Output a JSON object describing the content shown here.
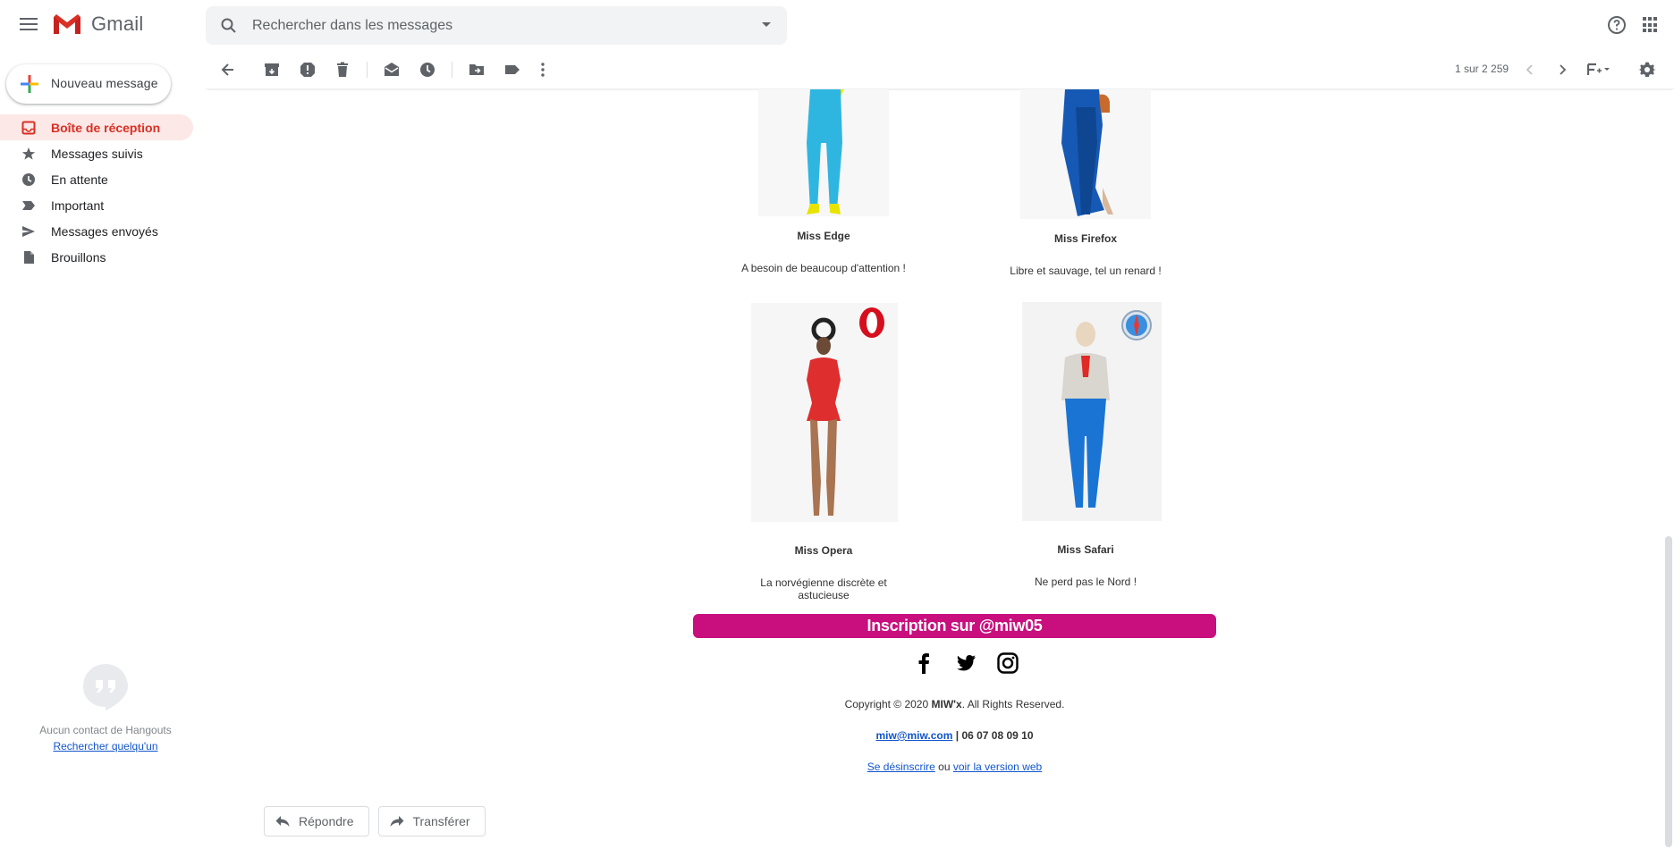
{
  "app": {
    "name": "Gmail",
    "brand_color": "#d93025"
  },
  "search": {
    "placeholder": "Rechercher dans les messages"
  },
  "compose": {
    "label": "Nouveau message"
  },
  "sidebar": {
    "items": [
      {
        "label": "Boîte de réception",
        "icon": "inbox-icon",
        "active": true
      },
      {
        "label": "Messages suivis",
        "icon": "star-icon",
        "active": false
      },
      {
        "label": "En attente",
        "icon": "clock-icon",
        "active": false
      },
      {
        "label": "Important",
        "icon": "important-icon",
        "active": false
      },
      {
        "label": "Messages envoyés",
        "icon": "send-icon",
        "active": false
      },
      {
        "label": "Brouillons",
        "icon": "draft-icon",
        "active": false
      }
    ]
  },
  "hangouts": {
    "empty_text": "Aucun contact de Hangouts",
    "link": "Rechercher quelqu'un"
  },
  "toolbar": {
    "pager": "1 sur 2 259",
    "icons": [
      "back-icon",
      "archive-icon",
      "report-spam-icon",
      "delete-icon",
      "mark-unread-icon",
      "snooze-icon",
      "move-to-icon",
      "label-icon",
      "more-icon"
    ]
  },
  "email": {
    "cards": [
      {
        "name": "Miss Edge",
        "desc": "A besoin de beaucoup d'attention !"
      },
      {
        "name": "Miss Firefox",
        "desc": "Libre et sauvage, tel un renard !"
      },
      {
        "name": "Miss Opera",
        "desc": "La norvégienne discrète et astucieuse"
      },
      {
        "name": "Miss Safari",
        "desc": "Ne perd pas le Nord !"
      }
    ],
    "cta": "Inscription sur @miw05",
    "cta_color": "#c80f7d",
    "social": [
      "facebook-icon",
      "twitter-icon",
      "instagram-icon"
    ],
    "copyright_prefix": "Copyright © 2020 ",
    "copyright_brand": "MIW'x",
    "copyright_suffix": ". All Rights Reserved.",
    "contact_email": "miw@miw.com",
    "contact_phone": " | 06 07 08 09 10",
    "unsubscribe": "Se désinscrire",
    "or_text": " ou ",
    "web_version": "voir la version web"
  },
  "actions": {
    "reply": "Répondre",
    "forward": "Transférer"
  }
}
